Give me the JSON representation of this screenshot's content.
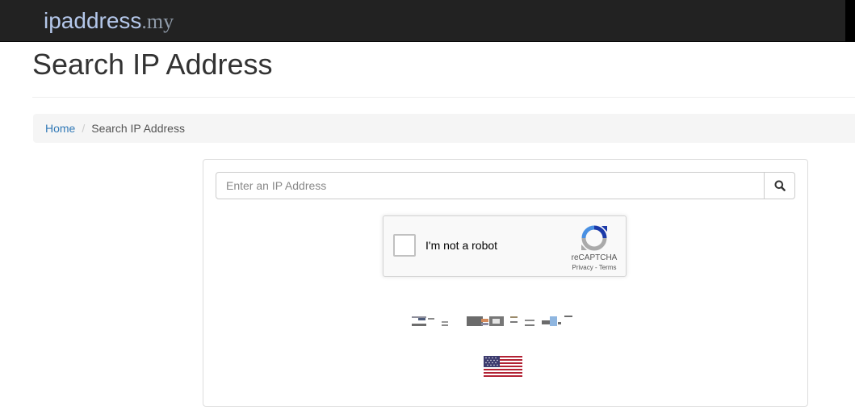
{
  "navbar": {
    "brand_main": "ipaddress",
    "brand_tld": ".my"
  },
  "page": {
    "title": "Search IP Address"
  },
  "breadcrumb": {
    "home": "Home",
    "separator": "/",
    "current": "Search IP Address"
  },
  "search": {
    "placeholder": "Enter an IP Address",
    "button_icon": "search-icon"
  },
  "recaptcha": {
    "label": "I'm not a robot",
    "brand": "reCAPTCHA",
    "privacy": "Privacy",
    "link_sep": " - ",
    "terms": "Terms"
  },
  "result": {
    "ip_text_obscured": true,
    "flag_icon": "us-flag-icon"
  },
  "colors": {
    "navbar_bg": "#222222",
    "link": "#337ab7",
    "breadcrumb_bg": "#f5f5f5"
  }
}
